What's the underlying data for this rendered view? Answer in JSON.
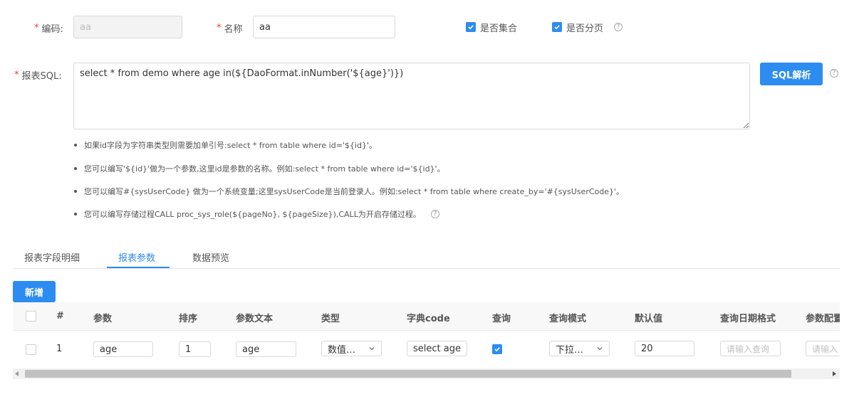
{
  "form": {
    "code": {
      "required": "*",
      "label": "编码:",
      "value": "aa"
    },
    "name": {
      "required": "*",
      "label": "名称",
      "value": "aa"
    },
    "is_collection": {
      "label": "是否集合",
      "checked": true
    },
    "is_paginated": {
      "label": "是否分页",
      "checked": true
    },
    "help_glyph": "?",
    "sql": {
      "required": "*",
      "label": "报表SQL:",
      "value": "select * from demo where age in(${DaoFormat.inNumber('${age}')})",
      "parse_button": "SQL解析"
    },
    "tips": [
      "如果id字段为字符串类型则需要加单引号:select * from table where id='${id}'。",
      "您可以编写'${id}'做为一个参数,这里id是参数的名称。例如:select * from table where id='${id}'。",
      "您可以编写#{sysUserCode} 做为一个系统变量;这里sysUserCode是当前登录人。例如:select * from table where create_by='#{sysUserCode}'。",
      "您可以编写存储过程CALL proc_sys_role(${pageNo}, ${pageSize}),CALL为开启存储过程。"
    ]
  },
  "tabs": [
    {
      "label": "报表字段明细",
      "active": false
    },
    {
      "label": "报表参数",
      "active": true
    },
    {
      "label": "数据预览",
      "active": false
    }
  ],
  "toolbar": {
    "add_label": "新增"
  },
  "table": {
    "headers": [
      "#",
      "参数",
      "排序",
      "参数文本",
      "类型",
      "字典code",
      "查询",
      "查询模式",
      "默认值",
      "查询日期格式",
      "参数配置"
    ],
    "rows": [
      {
        "index": "1",
        "param": "age",
        "order": "1",
        "param_text": "age",
        "type": "数值…",
        "dict_code": "select age",
        "query_checked": true,
        "query_mode": "下拉…",
        "default_value": "20",
        "date_format_placeholder": "请输入查询",
        "param_config_placeholder": "请输入"
      }
    ]
  },
  "colors": {
    "primary": "#2d8cf0",
    "required": "#f04134"
  }
}
